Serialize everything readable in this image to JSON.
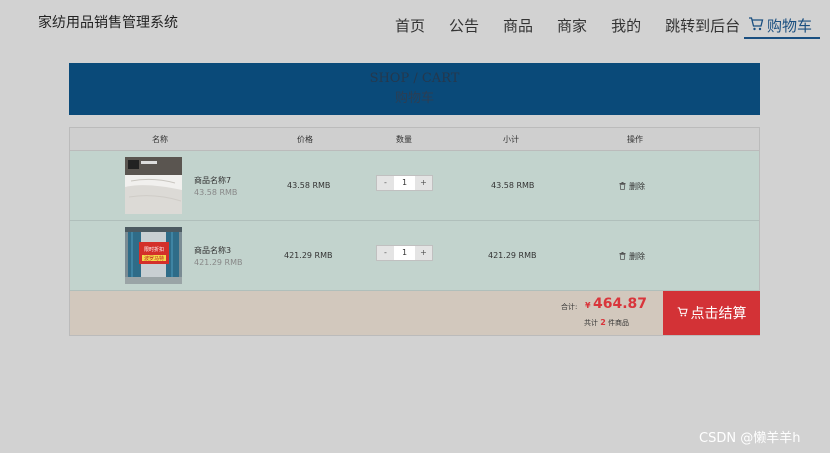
{
  "header": {
    "site_title": "家纺用品销售管理系统",
    "nav": [
      "首页",
      "公告",
      "商品",
      "商家",
      "我的",
      "跳转到后台"
    ],
    "cart_link": "购物车"
  },
  "banner": {
    "en": "SHOP / CART",
    "cn": "购物车"
  },
  "cart": {
    "columns": [
      "名称",
      "价格",
      "数量",
      "小计",
      "操作"
    ],
    "items": [
      {
        "name": "商品名称7",
        "unit": "43.58 RMB",
        "price": "43.58 RMB",
        "minus": "-",
        "qty": "1",
        "plus": "+",
        "subtotal": "43.58 RMB",
        "delete": "删除"
      },
      {
        "name": "商品名称3",
        "unit": "421.29 RMB",
        "price": "421.29 RMB",
        "minus": "-",
        "qty": "1",
        "plus": "+",
        "subtotal": "421.29 RMB",
        "delete": "删除",
        "image_text": [
          "限时折扣",
          "波罗马特"
        ]
      }
    ],
    "total_label": "合计:",
    "currency": "¥",
    "total": "464.87",
    "count_prefix": "共计",
    "count": "2",
    "count_suffix": "件商品",
    "checkout": "点击结算"
  },
  "watermark": "CSDN @懒羊羊h"
}
